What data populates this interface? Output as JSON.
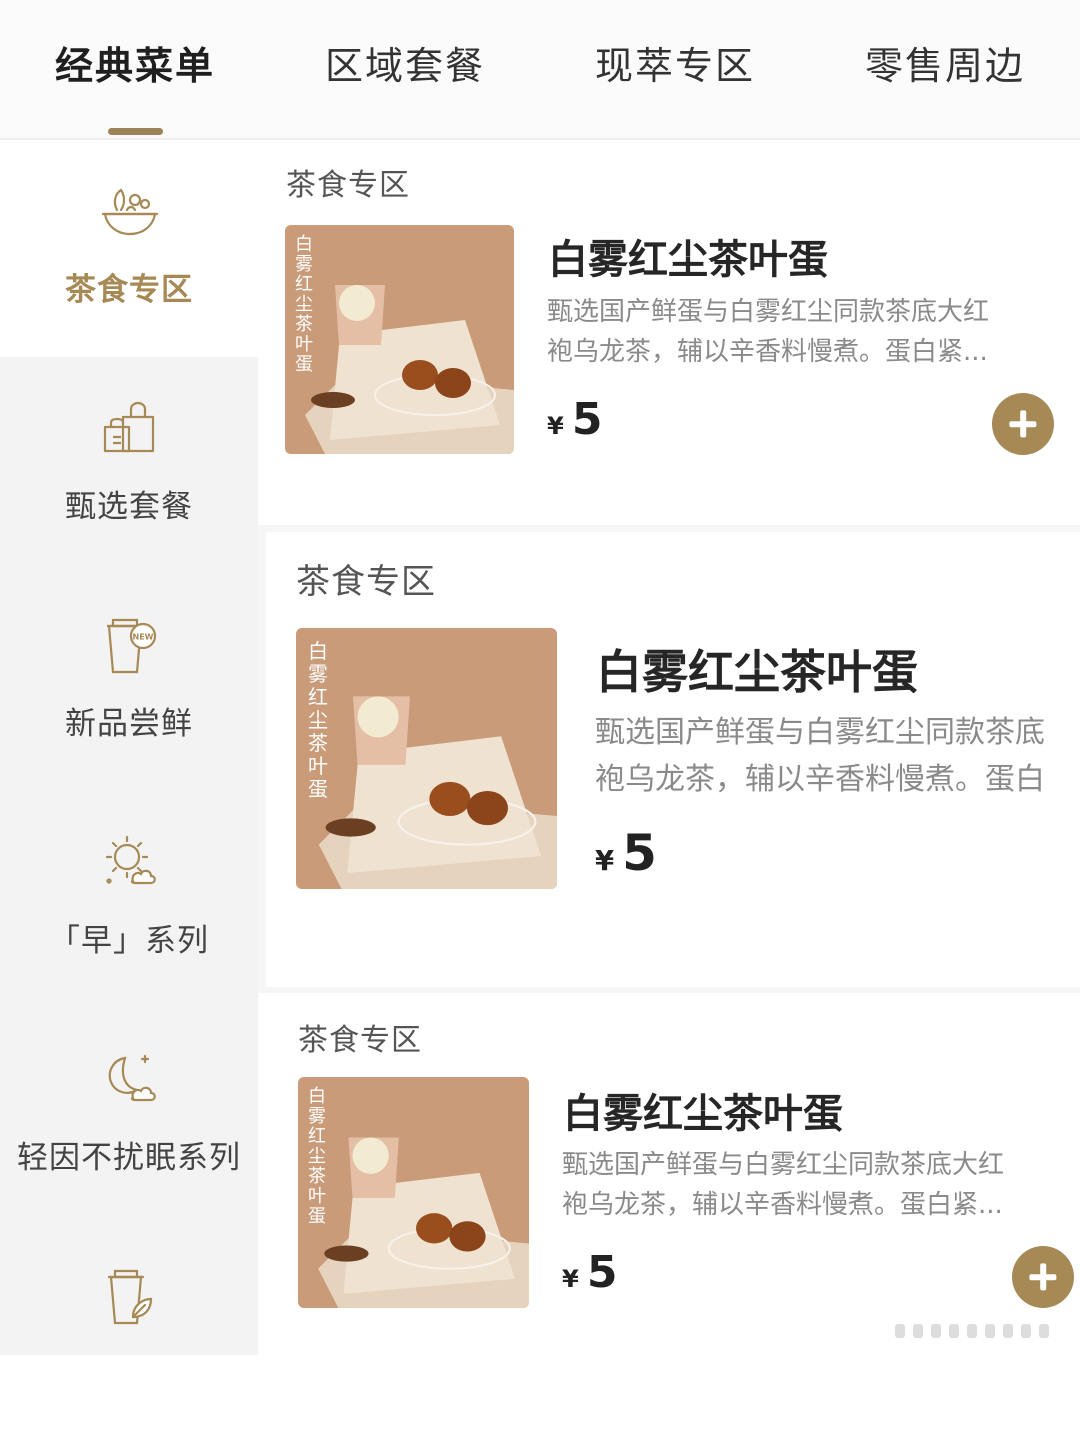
{
  "top_tabs": [
    "经典菜单",
    "区域套餐",
    "现萃专区",
    "零售周边"
  ],
  "sidebar": [
    {
      "label": "茶食专区",
      "icon": "bowl-icon",
      "active": true
    },
    {
      "label": "甄选套餐",
      "icon": "shopping-bag-icon"
    },
    {
      "label": "新品尝鲜",
      "icon": "new-cup-icon"
    },
    {
      "label": "「早」系列",
      "icon": "sun-cloud-icon"
    },
    {
      "label": "轻因不扰眠系列",
      "icon": "moon-cloud-icon"
    },
    {
      "label": "",
      "icon": "cup-leaf-icon"
    }
  ],
  "products": [
    {
      "section": "茶食专区",
      "image_text": "白雾红尘茶叶蛋",
      "name": "白雾红尘茶叶蛋",
      "desc_line1": "甄选国产鲜蛋与白雾红尘同款茶底大红",
      "desc_line2": "袍乌龙茶，辅以辛香料慢煮。蛋白紧...",
      "currency": "¥",
      "price": "5"
    },
    {
      "section": "茶食专区",
      "image_text": "白雾红尘茶叶蛋",
      "name": "白雾红尘茶叶蛋",
      "desc_line1": "甄选国产鲜蛋与白雾红尘同款茶底",
      "desc_line2": "袍乌龙茶，辅以辛香料慢煮。蛋白",
      "currency": "¥",
      "price": "5"
    },
    {
      "section": "茶食专区",
      "image_text": "白雾红尘茶叶蛋",
      "name": "白雾红尘茶叶蛋",
      "desc_line1": "甄选国产鲜蛋与白雾红尘同款茶底大红",
      "desc_line2": "袍乌龙茶，辅以辛香料慢煮。蛋白紧...",
      "currency": "¥",
      "price": "5"
    }
  ],
  "colors": {
    "accent": "#a68955",
    "active_label": "#a68955",
    "bg_sidebar": "#f3f3f3"
  }
}
